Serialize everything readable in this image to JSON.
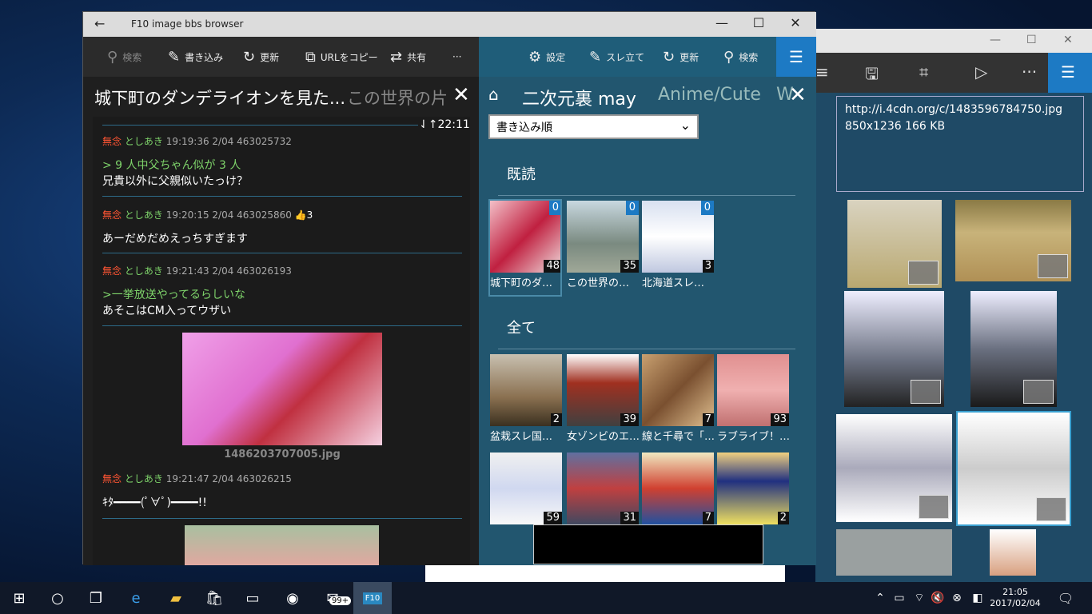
{
  "main_window": {
    "title": "F10 image bbs browser"
  },
  "left_toolbar": {
    "search": "検索",
    "write": "書き込み",
    "refresh": "更新",
    "copy_url": "URLをコピー",
    "share": "共有",
    "more": "···"
  },
  "left_tabs": {
    "active": "城下町のダンデライオンを見た...",
    "second": "この世界の片"
  },
  "thread": {
    "scroll_time": "22:11",
    "posts": [
      {
        "name": "無念",
        "user": "としあき",
        "meta": "19:19:36 2/04 463025732",
        "quote": "> 9 人中父ちゃん似が 3 人",
        "text": "兄貴以外に父親似いたっけ？"
      },
      {
        "name": "無念",
        "user": "としあき",
        "meta": "19:20:15 2/04 463025860",
        "likes": "3",
        "text": "あーだめだめえっちすぎます"
      },
      {
        "name": "無念",
        "user": "としあき",
        "meta": "19:21:43 2/04 463026193",
        "quote": ">一挙放送やってるらしいな",
        "text": "あそこはCM入ってウザい",
        "image_name": "1486203707005.jpg"
      },
      {
        "name": "無念",
        "user": "としあき",
        "meta": "19:21:47 2/04 463026215",
        "text": "ｷﾀ━━━━(ﾟ∀ﾟ)━━━━!!"
      }
    ]
  },
  "right_toolbar": {
    "settings": "設定",
    "new_thread": "スレ立て",
    "refresh": "更新",
    "search": "検索"
  },
  "right_tabs": {
    "active": "二次元裏 may",
    "second": "Anime/Cute",
    "third": "W"
  },
  "sort": {
    "selected": "書き込み順"
  },
  "sections": {
    "read": "既読",
    "all": "全て"
  },
  "read_threads": [
    {
      "caption": "城下町のダ…",
      "count": "48",
      "unread": "0"
    },
    {
      "caption": "この世界の…",
      "count": "35",
      "unread": "0"
    },
    {
      "caption": "北海道スレ…",
      "count": "3",
      "unread": "0"
    }
  ],
  "all_threads": [
    {
      "caption": "盆栽スレ国…",
      "count": "2"
    },
    {
      "caption": "女ゾンビのエ…",
      "count": "39"
    },
    {
      "caption": "線と千尋で「…",
      "count": "7"
    },
    {
      "caption": "ラブライブ！…",
      "count": "93"
    },
    {
      "caption": "",
      "count": "59"
    },
    {
      "caption": "",
      "count": "31"
    },
    {
      "caption": "",
      "count": "7"
    },
    {
      "caption": "",
      "count": "2"
    }
  ],
  "viewer": {
    "url": "http://i.4cdn.org/c/1483596784750.jpg",
    "info": "850x1236 166 KB"
  },
  "taskbar": {
    "time": "21:05",
    "date": "2017/02/04",
    "badge": "99+",
    "app_label": "F10"
  }
}
